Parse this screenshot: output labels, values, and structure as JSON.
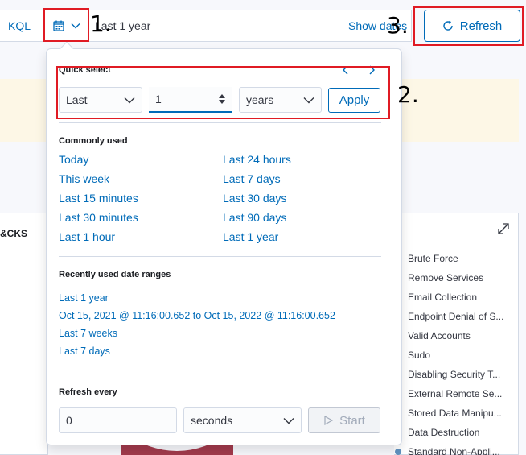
{
  "query_bar": {
    "language_label": "KQL",
    "range_text": "Last 1 year",
    "show_dates_label": "Show dates",
    "refresh_label": "Refresh"
  },
  "callouts": [
    "1.",
    "2.",
    "3."
  ],
  "quick_select": {
    "title": "Quick select",
    "direction": "Last",
    "amount": "1",
    "unit": "years",
    "apply_label": "Apply"
  },
  "commonly_used": {
    "title": "Commonly used",
    "left": [
      "Today",
      "This week",
      "Last 15 minutes",
      "Last 30 minutes",
      "Last 1 hour"
    ],
    "right": [
      "Last 24 hours",
      "Last 7 days",
      "Last 30 days",
      "Last 90 days",
      "Last 1 year"
    ]
  },
  "recent": {
    "title": "Recently used date ranges",
    "items": [
      "Last 1 year",
      "Oct 15, 2021 @ 11:16:00.652 to Oct 15, 2022 @ 11:16:00.652",
      "Last 7 weeks",
      "Last 7 days"
    ]
  },
  "refresh_every": {
    "title": "Refresh every",
    "value": "0",
    "unit": "seconds",
    "start_label": "Start"
  },
  "background_panel": {
    "left_title": "&CKS",
    "legend": [
      {
        "label": "Brute Force",
        "color": "#6092c0"
      },
      {
        "label": "Remove Services",
        "color": "#d36086"
      },
      {
        "label": "Email Collection",
        "color": "#54b399"
      },
      {
        "label": "Endpoint Denial of S...",
        "color": "#d6bf57"
      },
      {
        "label": "Valid Accounts",
        "color": "#9170b8"
      },
      {
        "label": "Sudo",
        "color": "#ca8eae"
      },
      {
        "label": "Disabling Security T...",
        "color": "#54b399"
      },
      {
        "label": "External Remote Se...",
        "color": "#aaa5c9"
      },
      {
        "label": "Stored Data Manipu...",
        "color": "#6092c0"
      },
      {
        "label": "Data Destruction",
        "color": "#e7664c"
      },
      {
        "label": "Standard Non-Appli...",
        "color": "#6092c0"
      }
    ]
  },
  "colors": {
    "accent": "#006bb8",
    "callout_box": "#e01b24",
    "warning_band": "#fdf7e6"
  }
}
